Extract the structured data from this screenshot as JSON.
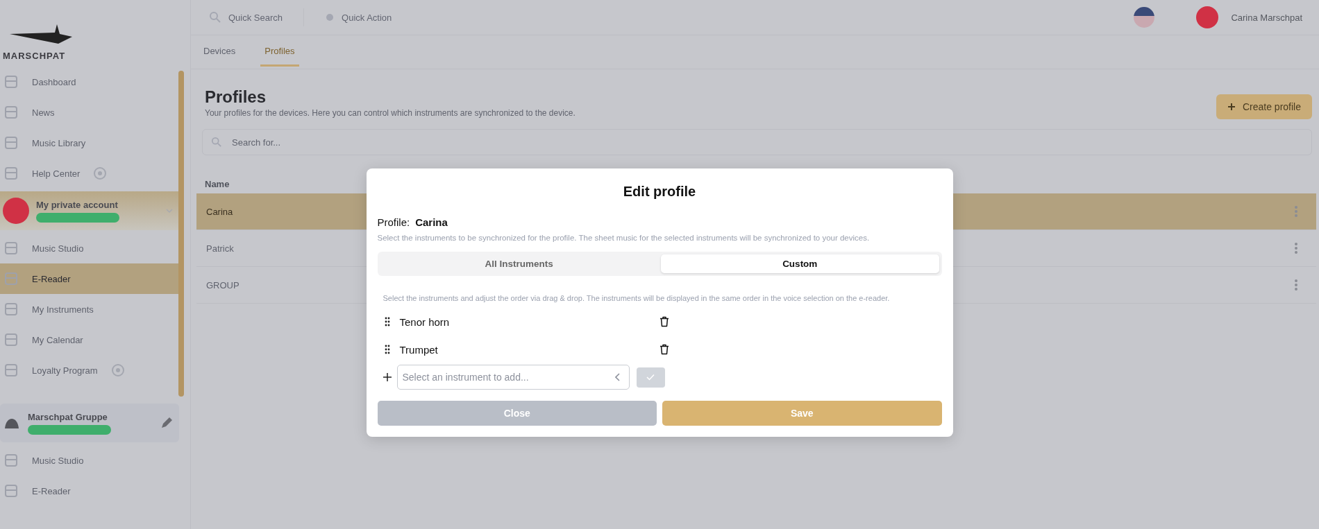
{
  "topbar": {
    "search": "Quick Search",
    "quick_action": "Quick Action",
    "user_name": "Carina Marschpat"
  },
  "sidebar": {
    "logo_text": "MARSCHPAT",
    "items": [
      {
        "kind": "link",
        "label": "Dashboard",
        "selected": false,
        "info": false
      },
      {
        "kind": "link",
        "label": "News",
        "selected": false,
        "info": false
      },
      {
        "kind": "link",
        "label": "Music Library",
        "selected": false,
        "info": false
      },
      {
        "kind": "link",
        "label": "Help Center",
        "selected": false,
        "info": true
      },
      {
        "kind": "account",
        "label": "My private account",
        "selected": false,
        "info": false
      },
      {
        "kind": "link",
        "label": "Music Studio",
        "selected": false,
        "info": false
      },
      {
        "kind": "link",
        "label": "E-Reader",
        "selected": true,
        "info": false
      },
      {
        "kind": "link",
        "label": "My Instruments",
        "selected": false,
        "info": false
      },
      {
        "kind": "link",
        "label": "My Calendar",
        "selected": false,
        "info": false
      },
      {
        "kind": "link",
        "label": "Loyalty Program",
        "selected": false,
        "info": true
      },
      {
        "kind": "group",
        "label": "Marschpat Gruppe",
        "selected": false,
        "info": false
      },
      {
        "kind": "link",
        "label": "Music Studio",
        "selected": false,
        "info": false
      },
      {
        "kind": "link",
        "label": "E-Reader",
        "selected": false,
        "info": false
      }
    ]
  },
  "tabs": [
    {
      "label": "Devices",
      "selected": false
    },
    {
      "label": "Profiles",
      "selected": true
    }
  ],
  "page": {
    "title": "Profiles",
    "subtitle": "Your profiles for the devices. Here you can control which instruments are synchronized to the device.",
    "create_button": "Create profile",
    "search_placeholder": "Search for...",
    "column": "Name",
    "rows": [
      {
        "name": "Carina",
        "selected": true
      },
      {
        "name": "Patrick",
        "selected": false
      },
      {
        "name": "GROUP",
        "selected": false
      }
    ]
  },
  "dialog": {
    "title": "Edit profile",
    "profile_label": "Profile:",
    "profile_name": "Carina",
    "description": "Select the instruments to be synchronized for the profile. The sheet music for the selected instruments will be synchronized to your devices.",
    "modes": [
      {
        "label": "All Instruments",
        "selected": false
      },
      {
        "label": "Custom",
        "selected": true
      }
    ],
    "hint": "Select the instruments and adjust the order via drag & drop. The instruments will be displayed in the same order in the voice selection on the e-reader.",
    "instruments": [
      "Tenor horn",
      "Trumpet"
    ],
    "add_placeholder": "Select an instrument to add...",
    "close": "Close",
    "save": "Save"
  }
}
